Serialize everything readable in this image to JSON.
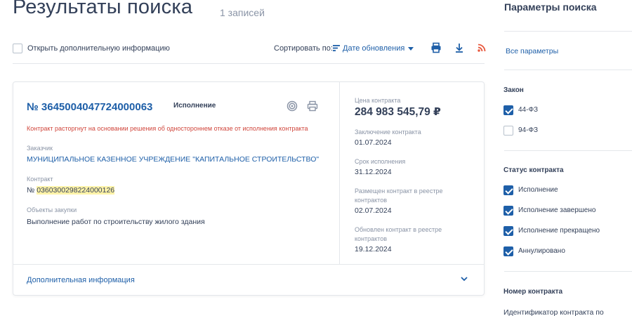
{
  "header": {
    "title": "Результаты поиска",
    "count": "1 записей"
  },
  "toolbar": {
    "open_info_label": "Открыть дополнительную информацию",
    "sort_label": "Сортировать по:",
    "sort_value": "Дате обновления"
  },
  "contract": {
    "number": "№ 3645004047724000063",
    "status": "Исполнение",
    "warning": "Контракт расторгнут на основании решения об одностороннем отказе от исполнения контракта",
    "customer_label": "Заказчик",
    "customer_value": "МУНИЦИПАЛЬНОЕ КАЗЕННОЕ УЧРЕЖДЕНИЕ \"КАПИТАЛЬНОЕ СТРОИТЕЛЬСТВО\"",
    "contract_label": "Контракт",
    "contract_prefix": "№ ",
    "contract_value": "0360300298224000126",
    "objects_label": "Объекты закупки",
    "objects_value": "Выполнение работ по строительству жилого здания",
    "price_label": "Цена контракта",
    "price_value": "284 983 545,79 ₽",
    "conclusion_label": "Заключение контракта",
    "conclusion_value": "01.07.2024",
    "term_label": "Срок исполнения",
    "term_value": "31.12.2024",
    "posted_label": "Размещен контракт в реестре контрактов",
    "posted_value": "02.07.2024",
    "updated_label": "Обновлен контракт в реестре контрактов",
    "updated_value": "19.12.2024",
    "more_info": "Дополнительная информация"
  },
  "sidebar": {
    "title": "Параметры поиска",
    "all_params": "Все параметры",
    "law_title": "Закон",
    "law_options": [
      {
        "label": "44-ФЗ",
        "checked": true
      },
      {
        "label": "94-ФЗ",
        "checked": false
      }
    ],
    "status_title": "Статус контракта",
    "status_options": [
      {
        "label": "Исполнение",
        "checked": true
      },
      {
        "label": "Исполнение завершено",
        "checked": true
      },
      {
        "label": "Исполнение прекращено",
        "checked": true
      },
      {
        "label": "Аннулировано",
        "checked": true
      }
    ],
    "number_title": "Номер контракта",
    "number_sub": "Идентификатор контракта по"
  },
  "colors": {
    "accent": "#1e5fa8",
    "text": "#334059",
    "muted": "#8a94a6",
    "warning": "#d0463c",
    "highlight": "#fff3a8",
    "rss": "#e8573c"
  }
}
